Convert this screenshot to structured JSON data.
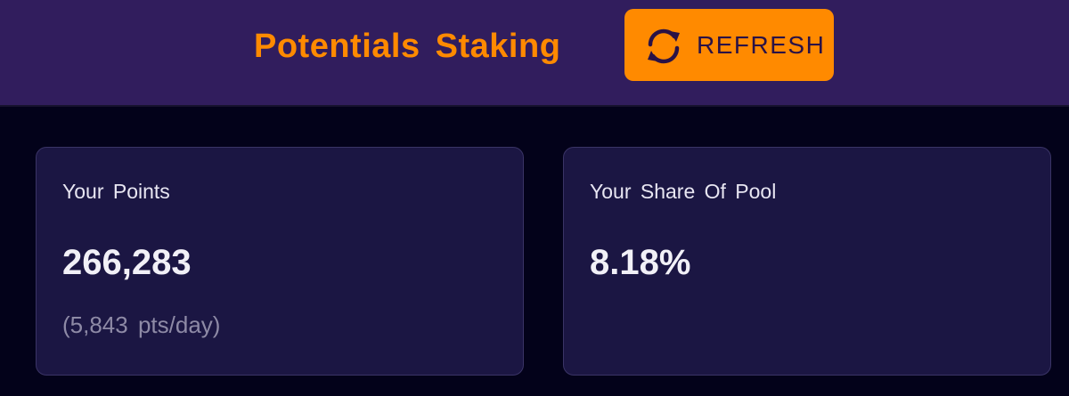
{
  "header": {
    "title": "Potentials Staking",
    "refresh_label": "REFRESH",
    "refresh_icon": "refresh-icon"
  },
  "cards": [
    {
      "label": "Your Points",
      "value": "266,283",
      "sub": "(5,843 pts/day)"
    },
    {
      "label": "Your Share Of Pool",
      "value": "8.18%"
    }
  ],
  "colors": {
    "header_bg": "#311d5d",
    "page_bg": "#03021a",
    "accent": "#ff8a00",
    "card_bg": "#1b1643",
    "card_border": "#3a3466",
    "muted_text": "#8e8aa6"
  }
}
